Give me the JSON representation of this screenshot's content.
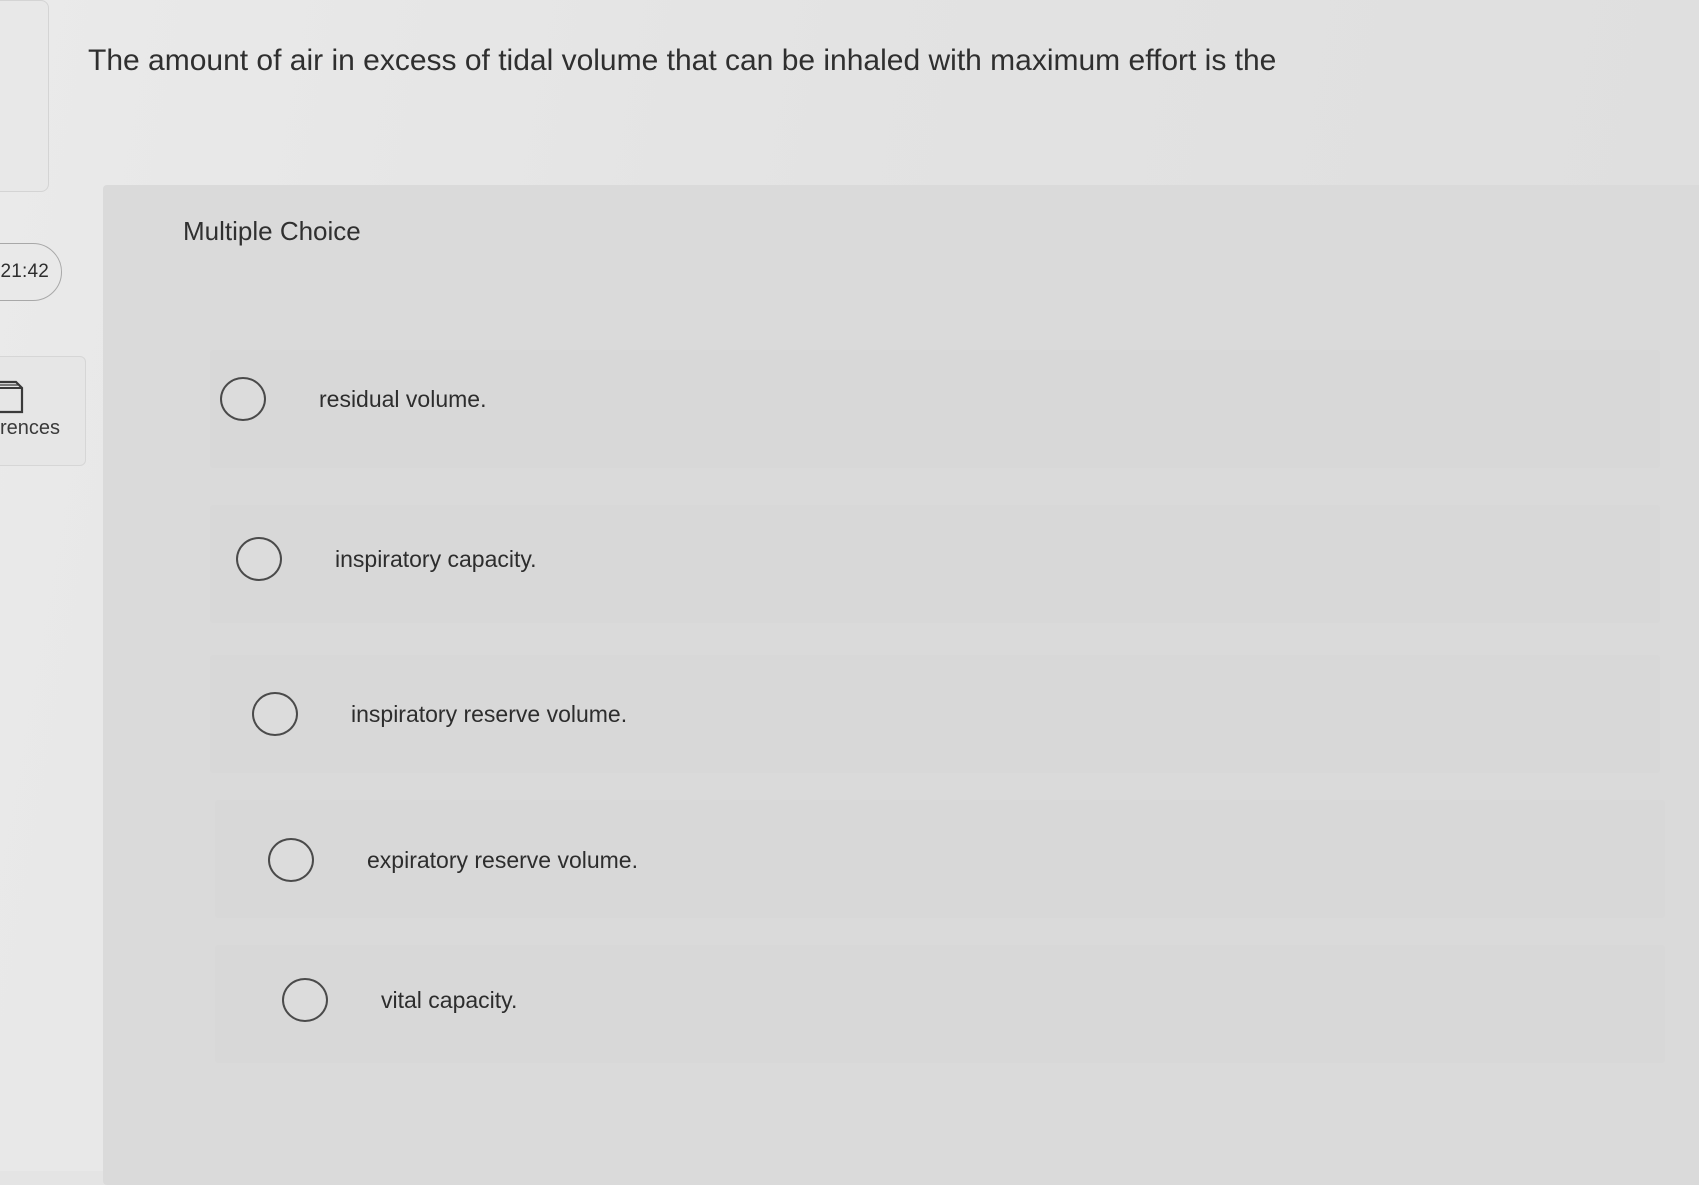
{
  "question": {
    "text": "The amount of air in excess of tidal volume that can be inhaled with maximum effort is the"
  },
  "question_type": "Multiple Choice",
  "timer": "21:42",
  "sidebar": {
    "references_label": "rences"
  },
  "options": [
    {
      "label": "residual volume."
    },
    {
      "label": "inspiratory capacity."
    },
    {
      "label": "inspiratory reserve volume."
    },
    {
      "label": "expiratory reserve volume."
    },
    {
      "label": "vital capacity."
    }
  ],
  "icons": {
    "references": "book-icon",
    "option_selector": "radio-circle"
  }
}
